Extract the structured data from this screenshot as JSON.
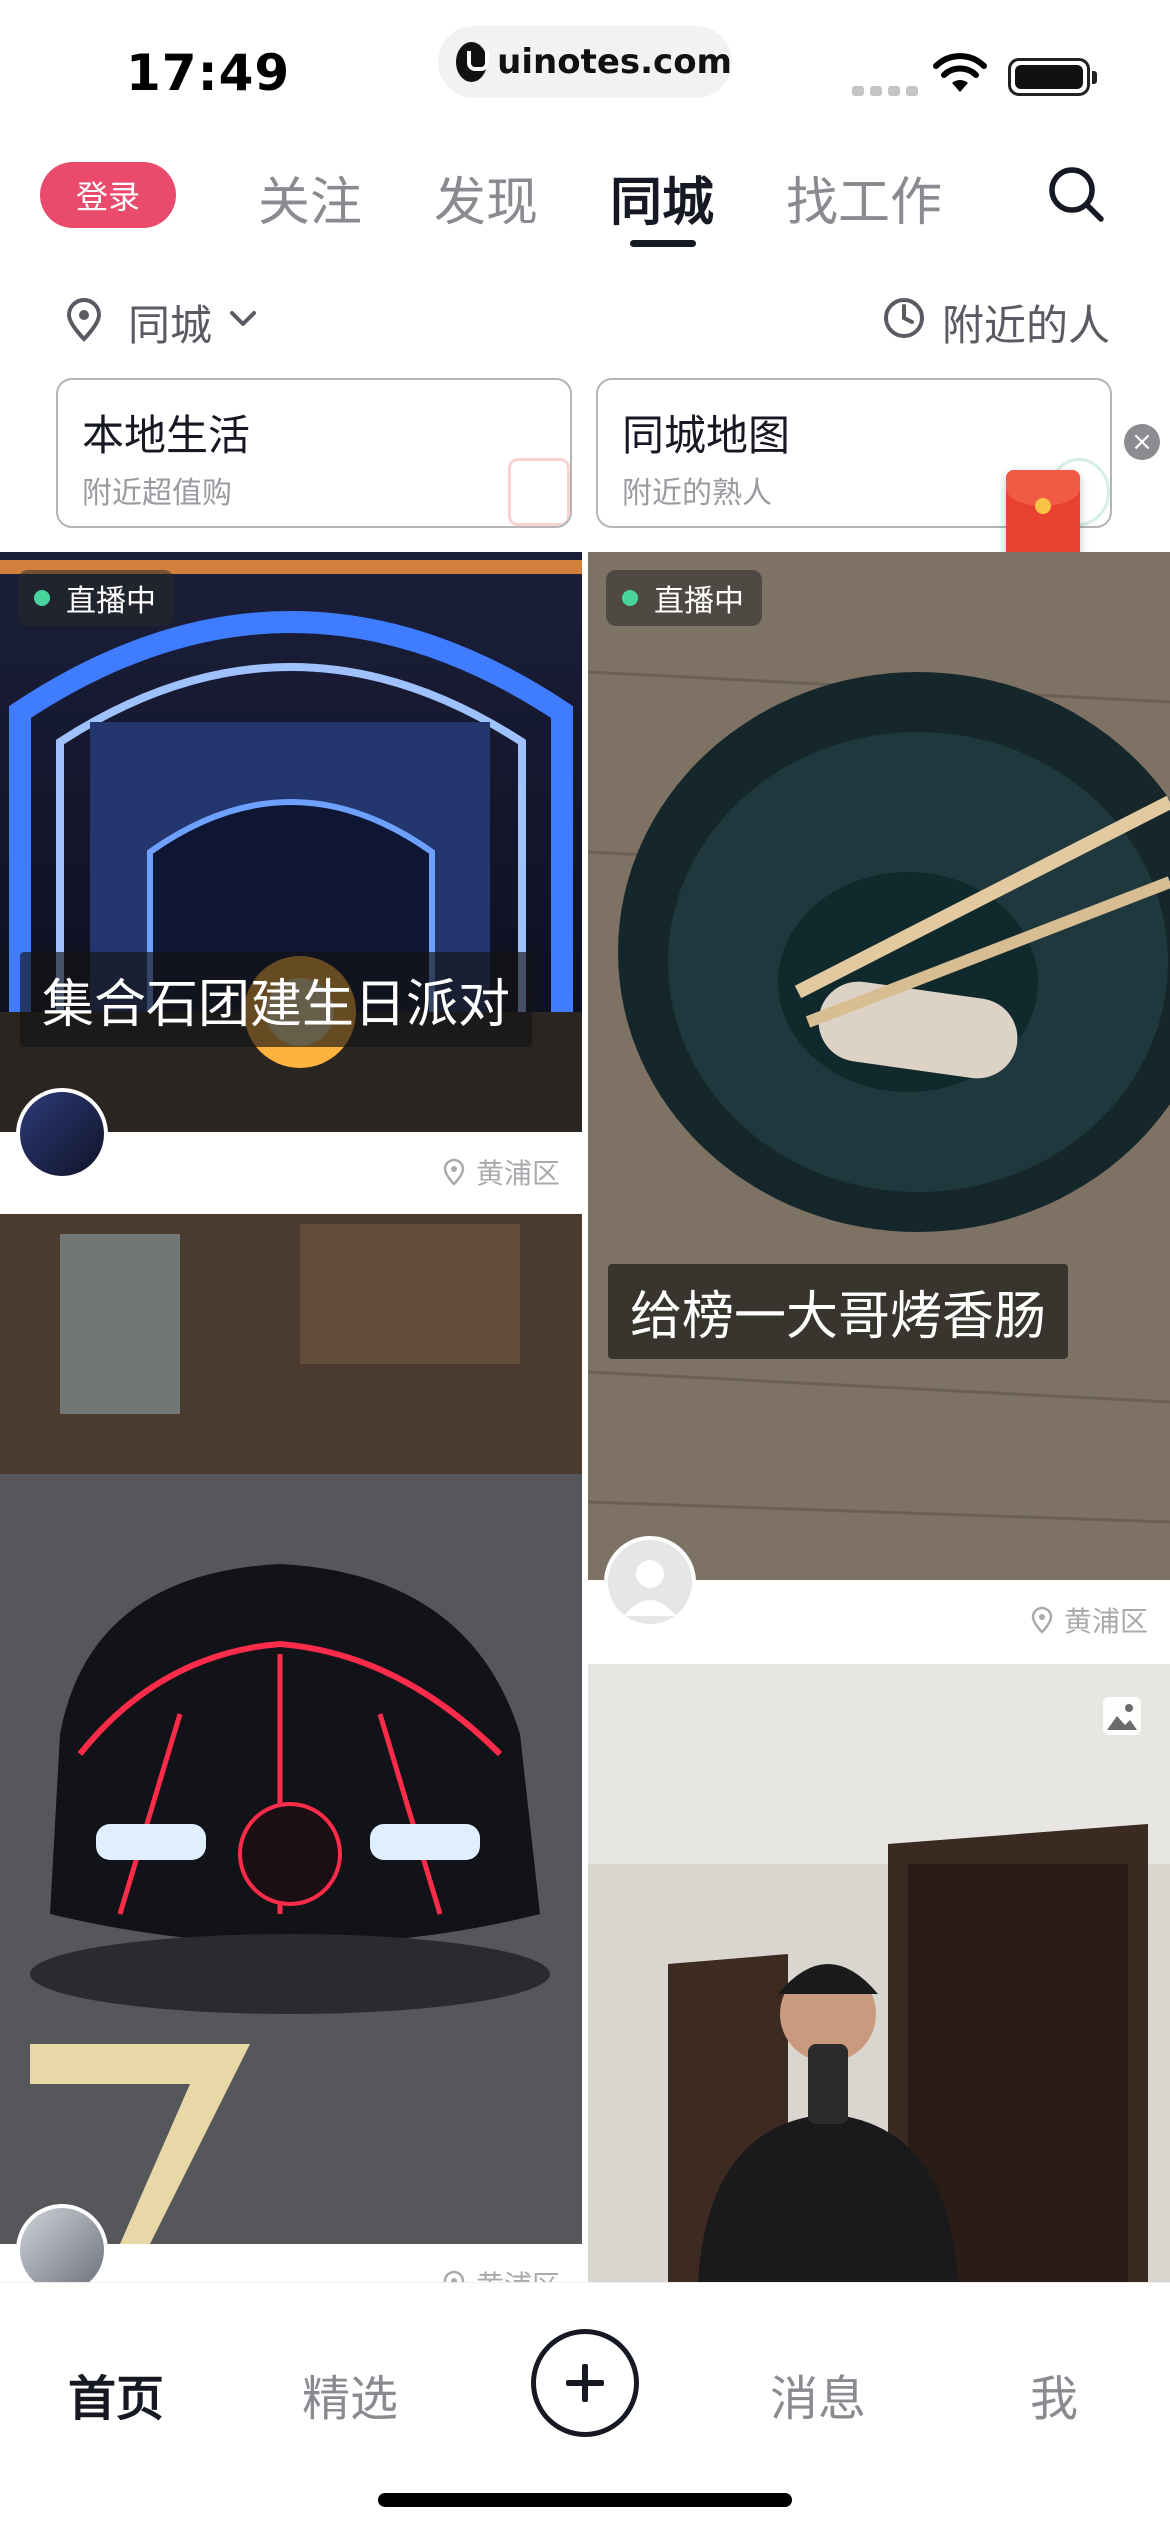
{
  "status_bar": {
    "time": "17:49",
    "url": "uinotes.com"
  },
  "top_nav": {
    "login": "登录",
    "tabs": [
      {
        "label": "关注",
        "active": false
      },
      {
        "label": "发现",
        "active": false
      },
      {
        "label": "同城",
        "active": true
      },
      {
        "label": "找工作",
        "active": false
      }
    ],
    "icons": [
      "search-icon"
    ]
  },
  "location_row": {
    "city": "同城",
    "nearby_people": "附近的人"
  },
  "service_cards": [
    {
      "title": "本地生活",
      "subtitle": "附近超值购"
    },
    {
      "title": "同城地图",
      "subtitle": "附近的熟人"
    }
  ],
  "feed": [
    {
      "badge": "直播中",
      "caption": "集合石团建生日派对",
      "district": "黄浦区"
    },
    {
      "badge": "直播中",
      "caption": "给榜一大哥烤香肠",
      "district": "黄浦区"
    },
    {
      "district": "黄浦区"
    },
    {}
  ],
  "bottom_bar": {
    "home": "首页",
    "featured": "精选",
    "messages": "消息",
    "me": "我"
  },
  "colors": {
    "accent": "#ea4a6c",
    "live_dot": "#49d49d",
    "text_primary": "#161823",
    "text_secondary": "#8a8b91"
  }
}
